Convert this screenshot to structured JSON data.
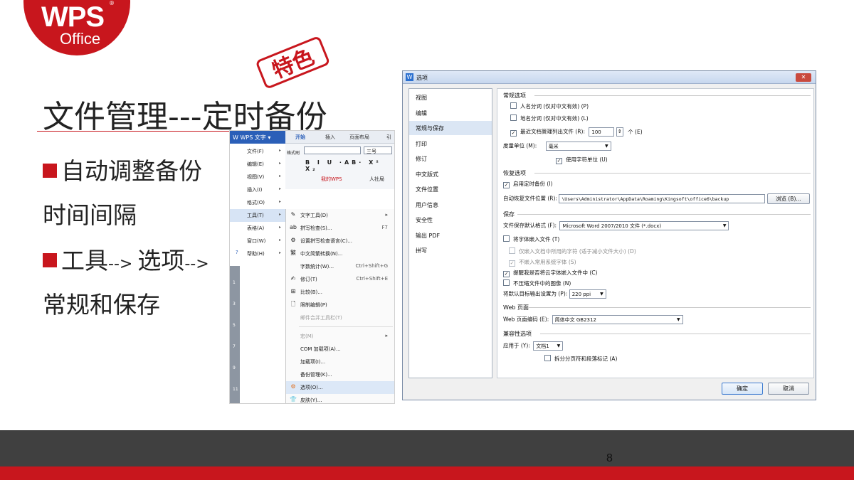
{
  "logo": {
    "wps": "WPS",
    "office": "Office",
    "reg": "®"
  },
  "stamp": {
    "text": "特色"
  },
  "title": "文件管理---定时备份",
  "bullets": {
    "b1": "自动调整备份",
    "b2": "时间间隔",
    "b3_a": "工具",
    "b3_b": "--> ",
    "b3_c": "选项",
    "b3_d": "-->",
    "b4": "常规和保存"
  },
  "menu_shot": {
    "app_button": "W WPS 文字 ▾",
    "ribbon_tabs": [
      "开始",
      "插入",
      "页面布局",
      "引"
    ],
    "left_menu": [
      {
        "label": "文件(F)"
      },
      {
        "label": "编辑(E)"
      },
      {
        "label": "视图(V)"
      },
      {
        "label": "插入(I)"
      },
      {
        "label": "格式(O)"
      },
      {
        "label": "工具(T)"
      },
      {
        "label": "表格(A)"
      },
      {
        "label": "窗口(W)"
      },
      {
        "label": "帮助(H)"
      }
    ],
    "toolbar": {
      "font_size": "三号",
      "doc_tab": "我的WPS",
      "doc_tab2": "人社局",
      "format_painter": "格式刷"
    },
    "submenu": [
      {
        "label": "文字工具(D)",
        "shortcut": "",
        "icon": "✎"
      },
      {
        "label": "拼写检查(S)...",
        "shortcut": "F7",
        "icon": "ab"
      },
      {
        "label": "设置拼写检查语言(C)...",
        "shortcut": "",
        "icon": "⚙"
      },
      {
        "label": "中文简繁转换(N)...",
        "shortcut": "",
        "icon": "繁"
      },
      {
        "label": "字数统计(W)...",
        "shortcut": "Ctrl+Shift+G",
        "icon": ""
      },
      {
        "label": "修订(T)",
        "shortcut": "Ctrl+Shift+E",
        "icon": "✍"
      },
      {
        "label": "比较(B)...",
        "shortcut": "",
        "icon": "⊞"
      },
      {
        "label": "限制编辑(P)",
        "shortcut": "",
        "icon": "🗋"
      },
      {
        "label": "邮件合并工具栏(T)",
        "shortcut": "",
        "icon": ""
      },
      {
        "label": "宏(M)",
        "shortcut": "",
        "icon": ""
      },
      {
        "label": "COM 加载项(A)...",
        "shortcut": "",
        "icon": ""
      },
      {
        "label": "加载项(I)...",
        "shortcut": "",
        "icon": ""
      },
      {
        "label": "备份管理(K)...",
        "shortcut": "",
        "icon": ""
      },
      {
        "label": "选项(O)...",
        "shortcut": "",
        "icon": "⚙"
      },
      {
        "label": "皮肤(Y)...",
        "shortcut": "",
        "icon": "👕"
      }
    ]
  },
  "dialog": {
    "title": "选项",
    "close": "✕",
    "nav": [
      "视图",
      "编辑",
      "常规与保存",
      "打印",
      "修订",
      "中文版式",
      "文件位置",
      "用户信息",
      "安全性",
      "输出 PDF",
      "拼写"
    ],
    "selected_nav": "常规与保存",
    "sections": {
      "general": "常规选项",
      "recovery": "恢复选项",
      "save": "保存",
      "web": "Web 页面",
      "compat": "兼容性选项"
    },
    "general": {
      "person_names": "人名分词 (仅对中文有效) (P)",
      "place_names": "地名分词 (仅对中文有效) (L)",
      "recent_files": "最近文档管理列出文件 (R):",
      "recent_count": "100",
      "recent_unit": "个 (E)",
      "measure_label": "度量单位 (M):",
      "measure_value": "毫米",
      "char_unit": "使用字符单位 (U)"
    },
    "recovery": {
      "timed_backup": "启用定时备份 (I)",
      "location_label": "自动恢复文件位置 (R):",
      "location_value": "\\Users\\Administrator\\AppData\\Roaming\\Kingsoft\\office6\\backup",
      "browse": "浏览 (B)..."
    },
    "save": {
      "format_label": "文件保存默认格式 (F):",
      "format_value": "Microsoft Word 2007/2010 文件 (*.docx)",
      "embed_fonts": "将字体嵌入文件 (T)",
      "embed_used_only": "仅嵌入文档中所用的字符 (适于减小文件大小) (D)",
      "no_system_fonts": "不嵌入常用系统字体 (S)",
      "remind_cloud": "提醒我是否将云字体嵌入文件中 (C)",
      "no_compress": "不压缩文件中的图像 (N)",
      "default_output": "将默认目标输出设置为 (P):",
      "ppi": "220 ppi"
    },
    "web": {
      "encoding_label": "Web 页面编码 (E):",
      "encoding_value": "简体中文 GB2312"
    },
    "compat": {
      "apply_label": "应用于 (Y):",
      "apply_value": "文档1",
      "split_pages": "拆分分页符和段落标记 (A)"
    },
    "ok": "确定",
    "cancel": "取消"
  },
  "page_number": "8",
  "colors": {
    "accent": "#c8161d",
    "footer_dark": "#404040"
  }
}
